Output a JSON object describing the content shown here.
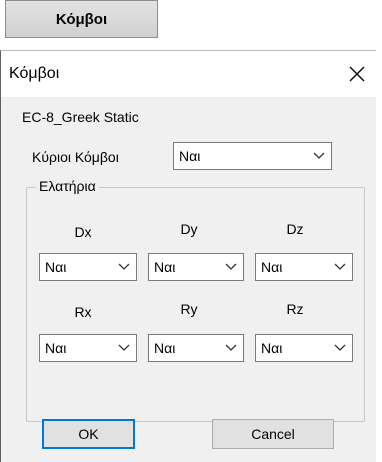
{
  "top_button": {
    "label": "Κόμβοι"
  },
  "dialog": {
    "title": "Κόμβοι",
    "subtitle": "EC-8_Greek Static",
    "main_nodes": {
      "label": "Κύριοι Κόμβοι",
      "value": "Ναι"
    },
    "springs_group": {
      "legend": "Ελατήρια",
      "translations": [
        {
          "label": "Dx",
          "value": "Ναι"
        },
        {
          "label": "Dy",
          "value": "Ναι"
        },
        {
          "label": "Dz",
          "value": "Ναι"
        }
      ],
      "rotations": [
        {
          "label": "Rx",
          "value": "Ναι"
        },
        {
          "label": "Ry",
          "value": "Ναι"
        },
        {
          "label": "Rz",
          "value": "Ναι"
        }
      ]
    },
    "ok_label": "OK",
    "cancel_label": "Cancel"
  }
}
